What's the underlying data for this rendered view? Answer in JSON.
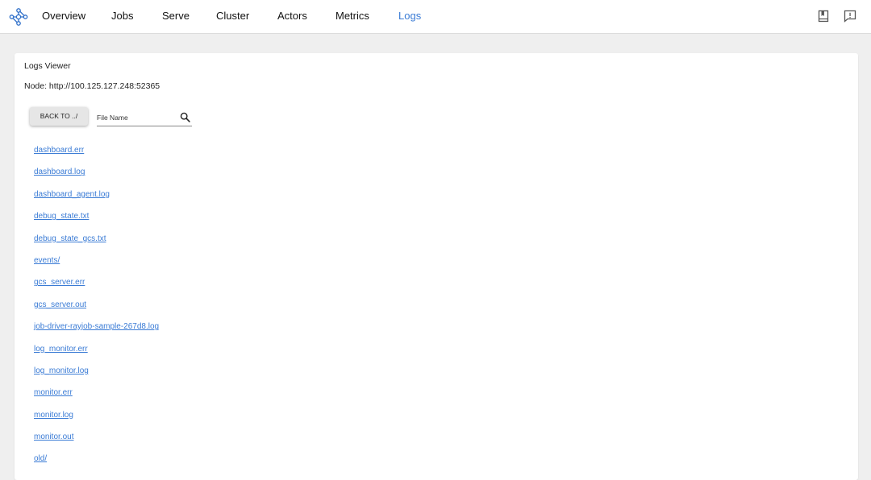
{
  "nav": {
    "items": [
      {
        "label": "Overview"
      },
      {
        "label": "Jobs"
      },
      {
        "label": "Serve"
      },
      {
        "label": "Cluster"
      },
      {
        "label": "Actors"
      },
      {
        "label": "Metrics"
      },
      {
        "label": "Logs",
        "active": true
      }
    ],
    "right_icons": [
      "docs-book-icon",
      "feedback-icon"
    ]
  },
  "logs_viewer": {
    "title": "Logs Viewer",
    "node_line": "Node: http://100.125.127.248:52365",
    "back_button": "BACK TO ../",
    "search_placeholder": "File Name",
    "files": [
      "dashboard.err",
      "dashboard.log",
      "dashboard_agent.log",
      "debug_state.txt",
      "debug_state_gcs.txt",
      "events/",
      "gcs_server.err",
      "gcs_server.out",
      "job-driver-rayjob-sample-267d8.log",
      "log_monitor.err",
      "log_monitor.log",
      "monitor.err",
      "monitor.log",
      "monitor.out",
      "old/"
    ]
  },
  "colors": {
    "accent": "#3a7bd5",
    "background": "#efefef",
    "card": "#ffffff"
  }
}
